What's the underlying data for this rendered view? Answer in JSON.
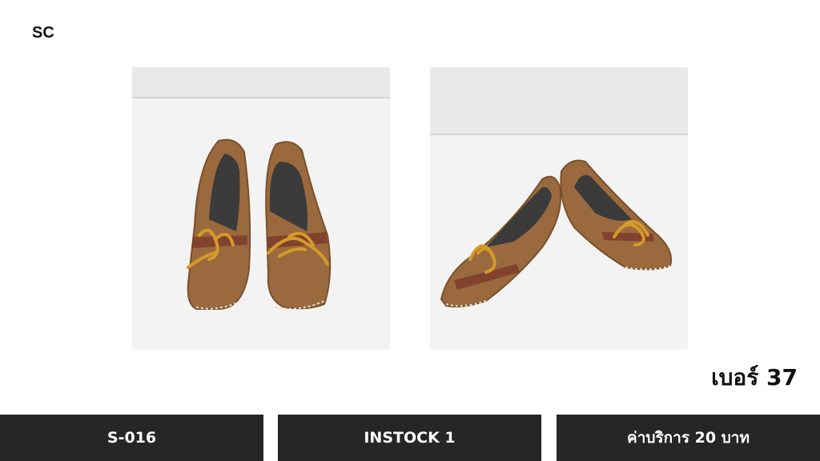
{
  "brand": "SC",
  "size_text": "เบอร์ 37",
  "footer": {
    "code": "S-016",
    "stock": "INSTOCK 1",
    "service_fee": "ค่าบริการ 20 บาท"
  },
  "colors": {
    "footer_bg": "#262626",
    "shoe_leather": "#9a6a3e",
    "lace": "#d49a2a"
  }
}
